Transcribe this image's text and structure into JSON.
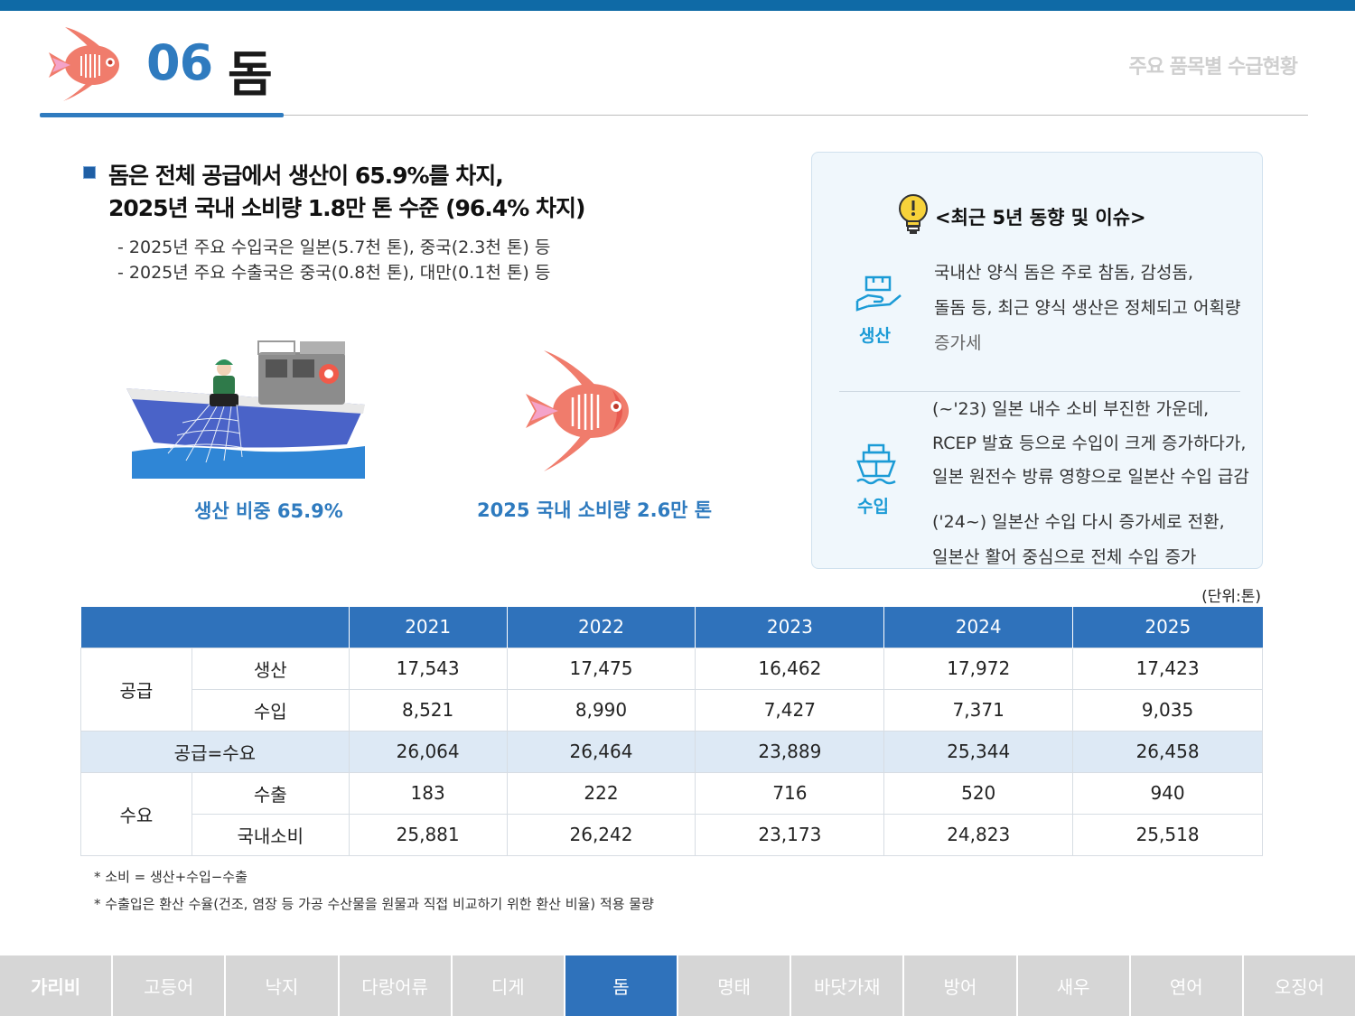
{
  "header": {
    "number": "06",
    "title": "돔",
    "section": "주요 품목별 수급현황"
  },
  "headline": {
    "line1": "돔은 전체 공급에서 생산이 65.9%를 차지,",
    "line2": "2025년 국내 소비량 1.8만 톤 수준 (96.4% 차지)"
  },
  "sub": {
    "line1": "- 2025년 주요 수입국은 일본(5.7천 톤), 중국(2.3천 톤) 등",
    "line2": "- 2025년 주요 수출국은 중국(0.8천 톤), 대만(0.1천 톤) 등"
  },
  "captions": {
    "production": "생산 비중 65.9%",
    "consumption": "2025 국내 소비량 2.6만 톤"
  },
  "trend": {
    "title": "<최근 5년 동향 및 이슈>",
    "production": {
      "label": "생산",
      "line1": "국내산 양식 돔은 주로 참돔, 감성돔,",
      "line2": "돌돔 등, 최근 양식 생산은 정체되고 어획량",
      "line3": "증가세"
    },
    "import": {
      "label": "수입",
      "line1": "(~'23) 일본 내수 소비 부진한 가운데,",
      "line2": "RCEP 발효 등으로 수입이 크게 증가하다가,",
      "line3": "일본 원전수 방류 영향으로 일본산 수입 급감",
      "line4": "('24~) 일본산 수입 다시 증가세로 전환,",
      "line5": "일본산 활어 중심으로 전체 수입 증가"
    }
  },
  "table": {
    "unit": "(단위:톤)",
    "years": [
      "2021",
      "2022",
      "2023",
      "2024",
      "2025"
    ],
    "supply_label": "공급",
    "demand_label": "수요",
    "total_label": "공급=수요",
    "rows": {
      "production": {
        "label": "생산",
        "values": [
          "17,543",
          "17,475",
          "16,462",
          "17,972",
          "17,423"
        ]
      },
      "import": {
        "label": "수입",
        "values": [
          "8,521",
          "8,990",
          "7,427",
          "7,371",
          "9,035"
        ]
      },
      "total": {
        "values": [
          "26,064",
          "26,464",
          "23,889",
          "25,344",
          "26,458"
        ]
      },
      "export": {
        "label": "수출",
        "values": [
          "183",
          "222",
          "716",
          "520",
          "940"
        ]
      },
      "domestic": {
        "label": "국내소비",
        "values": [
          "25,881",
          "26,242",
          "23,173",
          "24,823",
          "25,518"
        ]
      }
    }
  },
  "notes": {
    "line1": "* 소비 = 생산+수입−수출",
    "line2": "* 수출입은 환산 수율(건조, 염장 등 가공 수산물을 원물과 직접 비교하기 위한 환산 비율) 적용 물량"
  },
  "nav": [
    "가리비",
    "고등어",
    "낙지",
    "다랑어류",
    "디게",
    "돔",
    "명태",
    "바닷가재",
    "방어",
    "새우",
    "연어",
    "오징어"
  ],
  "colors": {
    "accent": "#2f72bb",
    "topbar": "#0f6aa6",
    "fish": "#f07c6c",
    "icon": "#1b9bd6",
    "nav_inactive": "#d6d6d6"
  }
}
